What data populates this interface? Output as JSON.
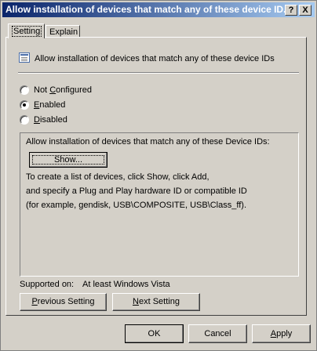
{
  "window": {
    "title": "Allow installation of devices that match any of these device ID...",
    "help_label": "?",
    "close_label": "X"
  },
  "tabs": [
    {
      "label": "Setting",
      "active": true
    },
    {
      "label": "Explain",
      "active": false
    }
  ],
  "policy": {
    "icon": "policy-setting-icon",
    "title": "Allow installation of devices that match any of these device IDs"
  },
  "state": {
    "options": [
      {
        "label": "Not Configured",
        "selected": false
      },
      {
        "label": "Enabled",
        "selected": true
      },
      {
        "label": "Disabled",
        "selected": false
      }
    ]
  },
  "options_panel": {
    "heading": "Allow installation of devices that match any of these Device IDs:",
    "show_button": "Show...",
    "help_lines": [
      "To create a list of devices, click Show, click Add,",
      "and specify a Plug and Play hardware ID or compatible ID",
      "(for example, gendisk, USB\\COMPOSITE, USB\\Class_ff)."
    ]
  },
  "supported": {
    "label": "Supported on:",
    "value": "At least Windows Vista"
  },
  "navigation": {
    "previous": "Previous Setting",
    "next": "Next Setting"
  },
  "footer": {
    "ok": "OK",
    "cancel": "Cancel",
    "apply": "Apply"
  }
}
